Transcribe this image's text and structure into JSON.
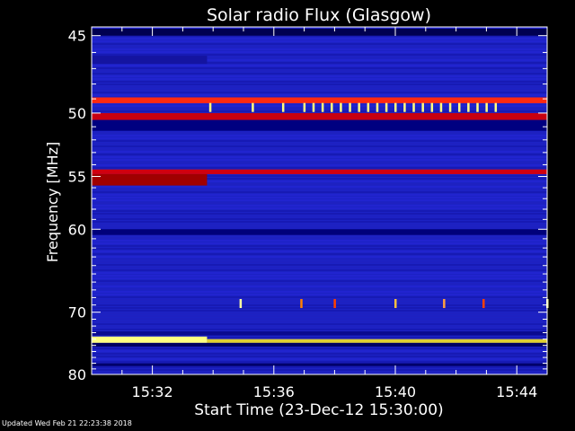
{
  "chart_data": {
    "type": "heatmap",
    "title": "Solar radio Flux (Glasgow)",
    "xlabel": "Start Time (23-Dec-12 15:30:00)",
    "ylabel": "Frequency [MHz]",
    "x_tick_labels": [
      "15:32",
      "15:36",
      "15:40",
      "15:44"
    ],
    "x_tick_minutes": [
      2,
      6,
      10,
      14
    ],
    "xlim_minutes": [
      0,
      15
    ],
    "y_tick_labels": [
      "45",
      "50",
      "55",
      "60",
      "70",
      "80"
    ],
    "y_tick_values": [
      45,
      50,
      55,
      60,
      70,
      80
    ],
    "ylim": [
      44.5,
      80
    ],
    "y_scale": "reciprocal",
    "colormap": [
      "#000080",
      "#1a1acc",
      "#2a2af0",
      "#a00000",
      "#ff2000",
      "#ff8000",
      "#ffff40",
      "#ffffa0"
    ],
    "background_color": "#1c22c4",
    "bands": [
      {
        "freq_from": 44.6,
        "freq_to": 45.0,
        "color": "#000050"
      },
      {
        "freq_from": 46.2,
        "freq_to": 46.7,
        "color": "#1414a0",
        "time_to": 3.8
      },
      {
        "freq_from": 48.9,
        "freq_to": 49.3,
        "color": "#ff2a10"
      },
      {
        "freq_from": 50.0,
        "freq_to": 50.5,
        "color": "#c80010"
      },
      {
        "freq_from": 50.5,
        "freq_to": 51.3,
        "color": "#000080"
      },
      {
        "freq_from": 54.4,
        "freq_to": 54.8,
        "color": "#d00010"
      },
      {
        "freq_from": 54.8,
        "freq_to": 55.8,
        "color": "#a00000",
        "time_to": 3.8
      },
      {
        "freq_from": 60.0,
        "freq_to": 60.6,
        "color": "#00007a"
      },
      {
        "freq_from": 72.8,
        "freq_to": 73.4,
        "color": "#0a0a90"
      },
      {
        "freq_from": 73.6,
        "freq_to": 74.6,
        "color": "#ffff80",
        "time_to": 3.8
      },
      {
        "freq_from": 74.0,
        "freq_to": 74.6,
        "color": "#e0d030",
        "time_from": 3.8
      },
      {
        "freq_from": 74.6,
        "freq_to": 75.2,
        "color": "#000060"
      },
      {
        "freq_from": 78.0,
        "freq_to": 78.5,
        "color": "#00006a"
      }
    ],
    "bursts": [
      {
        "time": 3.9,
        "freq": 49.6,
        "color": "#ffff80"
      },
      {
        "time": 5.3,
        "freq": 49.6,
        "color": "#ffff80"
      },
      {
        "time": 6.3,
        "freq": 49.6,
        "color": "#ffff80"
      },
      {
        "time": 7.0,
        "freq": 49.6,
        "color": "#ffff80"
      },
      {
        "time": 7.3,
        "freq": 49.6,
        "color": "#ffff80"
      },
      {
        "time": 7.6,
        "freq": 49.6,
        "color": "#ffff80"
      },
      {
        "time": 7.9,
        "freq": 49.6,
        "color": "#ffff80"
      },
      {
        "time": 8.2,
        "freq": 49.6,
        "color": "#ffff80"
      },
      {
        "time": 8.5,
        "freq": 49.6,
        "color": "#ffff80"
      },
      {
        "time": 8.8,
        "freq": 49.6,
        "color": "#ffff80"
      },
      {
        "time": 9.1,
        "freq": 49.6,
        "color": "#ffff80"
      },
      {
        "time": 9.4,
        "freq": 49.6,
        "color": "#ffff80"
      },
      {
        "time": 9.7,
        "freq": 49.6,
        "color": "#ffff80"
      },
      {
        "time": 10.0,
        "freq": 49.6,
        "color": "#ffff80"
      },
      {
        "time": 10.3,
        "freq": 49.6,
        "color": "#ffff80"
      },
      {
        "time": 10.6,
        "freq": 49.6,
        "color": "#ffff80"
      },
      {
        "time": 10.9,
        "freq": 49.6,
        "color": "#ffff80"
      },
      {
        "time": 11.2,
        "freq": 49.6,
        "color": "#ffff80"
      },
      {
        "time": 11.5,
        "freq": 49.6,
        "color": "#ffff80"
      },
      {
        "time": 11.8,
        "freq": 49.6,
        "color": "#ffff80"
      },
      {
        "time": 12.1,
        "freq": 49.6,
        "color": "#ffff80"
      },
      {
        "time": 12.4,
        "freq": 49.6,
        "color": "#ffff80"
      },
      {
        "time": 12.7,
        "freq": 49.6,
        "color": "#ffff80"
      },
      {
        "time": 13.0,
        "freq": 49.6,
        "color": "#ffff80"
      },
      {
        "time": 13.3,
        "freq": 49.6,
        "color": "#ffff80"
      },
      {
        "time": 4.9,
        "freq": 68.8,
        "color": "#ffffa0"
      },
      {
        "time": 6.9,
        "freq": 68.8,
        "color": "#ff8000"
      },
      {
        "time": 8.0,
        "freq": 68.8,
        "color": "#ff4000"
      },
      {
        "time": 10.0,
        "freq": 68.8,
        "color": "#ffc040"
      },
      {
        "time": 11.6,
        "freq": 68.8,
        "color": "#ffa040"
      },
      {
        "time": 12.9,
        "freq": 68.8,
        "color": "#ff4000"
      },
      {
        "time": 15.0,
        "freq": 68.8,
        "color": "#ffffa0"
      }
    ],
    "grid": false
  },
  "footer": {
    "updated_text": "Updated Wed Feb 21 22:23:38 2018"
  }
}
